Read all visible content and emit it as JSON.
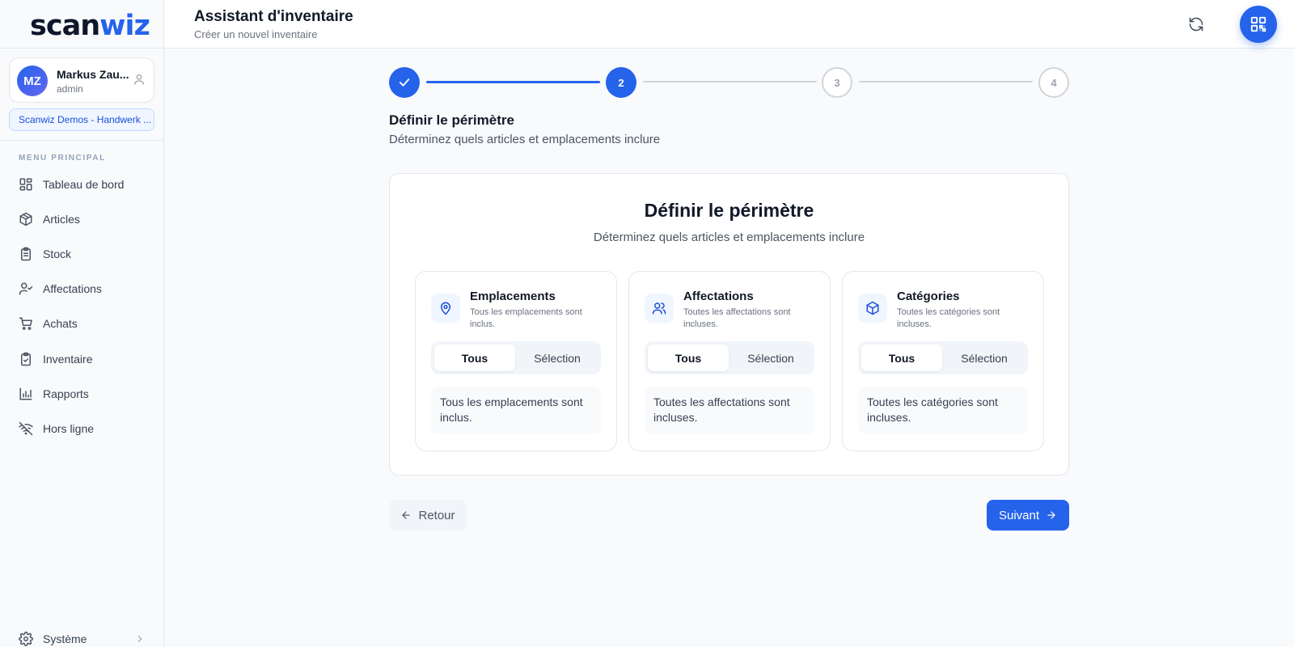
{
  "app": {
    "logo_part1": "scan",
    "logo_part2": "wiz"
  },
  "user": {
    "initials": "MZ",
    "name": "Markus Zau...",
    "role": "admin"
  },
  "organization": "Scanwiz Demos - Handwerk ...",
  "sidebar": {
    "menu_header": "MENU PRINCIPAL",
    "items": [
      {
        "label": "Tableau de bord",
        "icon": "dashboard-icon"
      },
      {
        "label": "Articles",
        "icon": "box-icon"
      },
      {
        "label": "Stock",
        "icon": "clipboard-list-icon"
      },
      {
        "label": "Affectations",
        "icon": "user-check-icon"
      },
      {
        "label": "Achats",
        "icon": "cart-icon"
      },
      {
        "label": "Inventaire",
        "icon": "clipboard-check-icon"
      },
      {
        "label": "Rapports",
        "icon": "bar-chart-icon"
      },
      {
        "label": "Hors ligne",
        "icon": "wifi-off-icon"
      }
    ],
    "system": {
      "label": "Système",
      "icon": "gear-icon"
    }
  },
  "header": {
    "title": "Assistant d'inventaire",
    "subtitle": "Créer un nouvel inventaire"
  },
  "stepper": {
    "steps": [
      {
        "label": "",
        "state": "done"
      },
      {
        "label": "2",
        "state": "active"
      },
      {
        "label": "3",
        "state": "pending"
      },
      {
        "label": "4",
        "state": "pending"
      }
    ]
  },
  "section": {
    "title": "Définir le périmètre",
    "subtitle": "Déterminez quels articles et emplacements inclure"
  },
  "card": {
    "title": "Définir le périmètre",
    "subtitle": "Déterminez quels articles et emplacements inclure",
    "scopes": [
      {
        "title": "Emplacements",
        "description": "Tous les emplacements sont inclus.",
        "icon": "map-pin-icon",
        "option_all": "Tous",
        "option_select": "Sélection",
        "info": "Tous les emplacements sont inclus."
      },
      {
        "title": "Affectations",
        "description": "Toutes les affectations sont incluses.",
        "icon": "users-icon",
        "option_all": "Tous",
        "option_select": "Sélection",
        "info": "Toutes les affectations sont incluses."
      },
      {
        "title": "Catégories",
        "description": "Toutes les catégories sont incluses.",
        "icon": "box-icon",
        "option_all": "Tous",
        "option_select": "Sélection",
        "info": "Toutes les catégories sont incluses."
      }
    ]
  },
  "footer": {
    "back_label": "Retour",
    "next_label": "Suivant"
  },
  "colors": {
    "accent": "#2563eb",
    "border": "#e5e7eb",
    "background": "#f8fafc"
  }
}
